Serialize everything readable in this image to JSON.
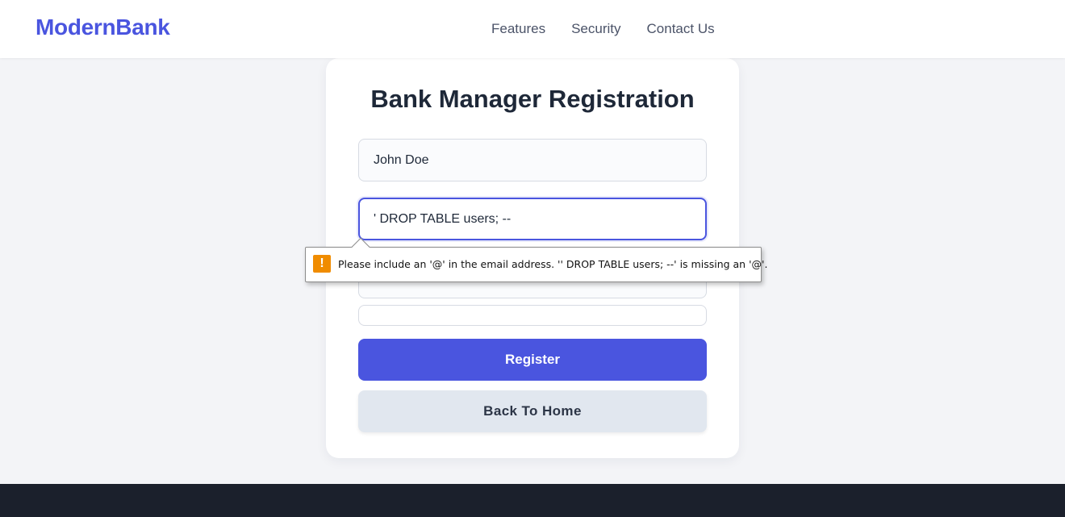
{
  "brand": {
    "name": "ModernBank",
    "accent_color": "#4a55df"
  },
  "nav": {
    "links": [
      {
        "label": "Features"
      },
      {
        "label": "Security"
      },
      {
        "label": "Contact Us"
      }
    ]
  },
  "form": {
    "title": "Bank Manager Registration",
    "fields": {
      "name_value": "John Doe",
      "email_value": "' DROP TABLE users; --",
      "third_value": "",
      "fourth_value": ""
    },
    "register_label": "Register",
    "back_label": "Back To Home"
  },
  "validation_tooltip": {
    "icon": "warning-icon",
    "icon_glyph": "!",
    "icon_color": "#f08c00",
    "message": "Please include an '@' in the email address. '' DROP TABLE users; --' is missing an '@'."
  }
}
